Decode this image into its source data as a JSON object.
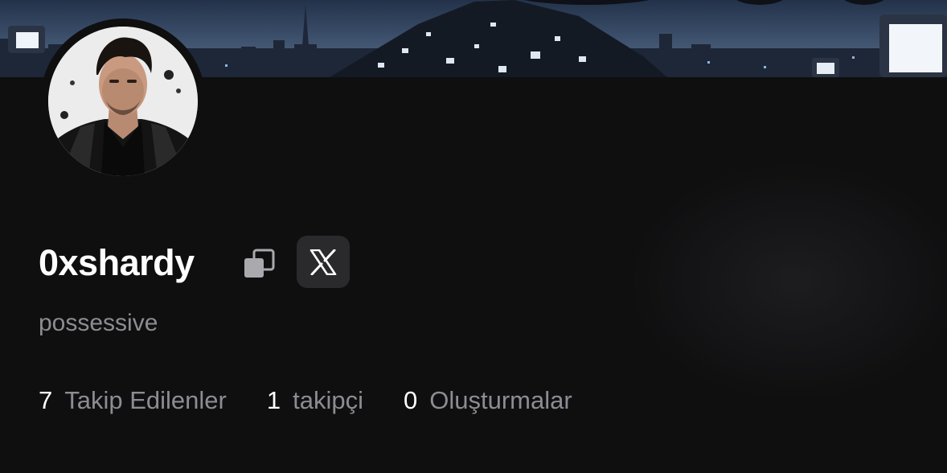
{
  "profile": {
    "username": "0xshardy",
    "bio": "possessive"
  },
  "icons": {
    "copy": "copy-icon",
    "social": "x-logo-icon"
  },
  "stats": [
    {
      "count": "7",
      "label": "Takip Edilenler"
    },
    {
      "count": "1",
      "label": "takipçi"
    },
    {
      "count": "0",
      "label": "Oluşturmalar"
    }
  ],
  "colors": {
    "background": "#0f0f10",
    "muted_text": "#8c8c92",
    "button_bg": "#2a2a2d"
  }
}
